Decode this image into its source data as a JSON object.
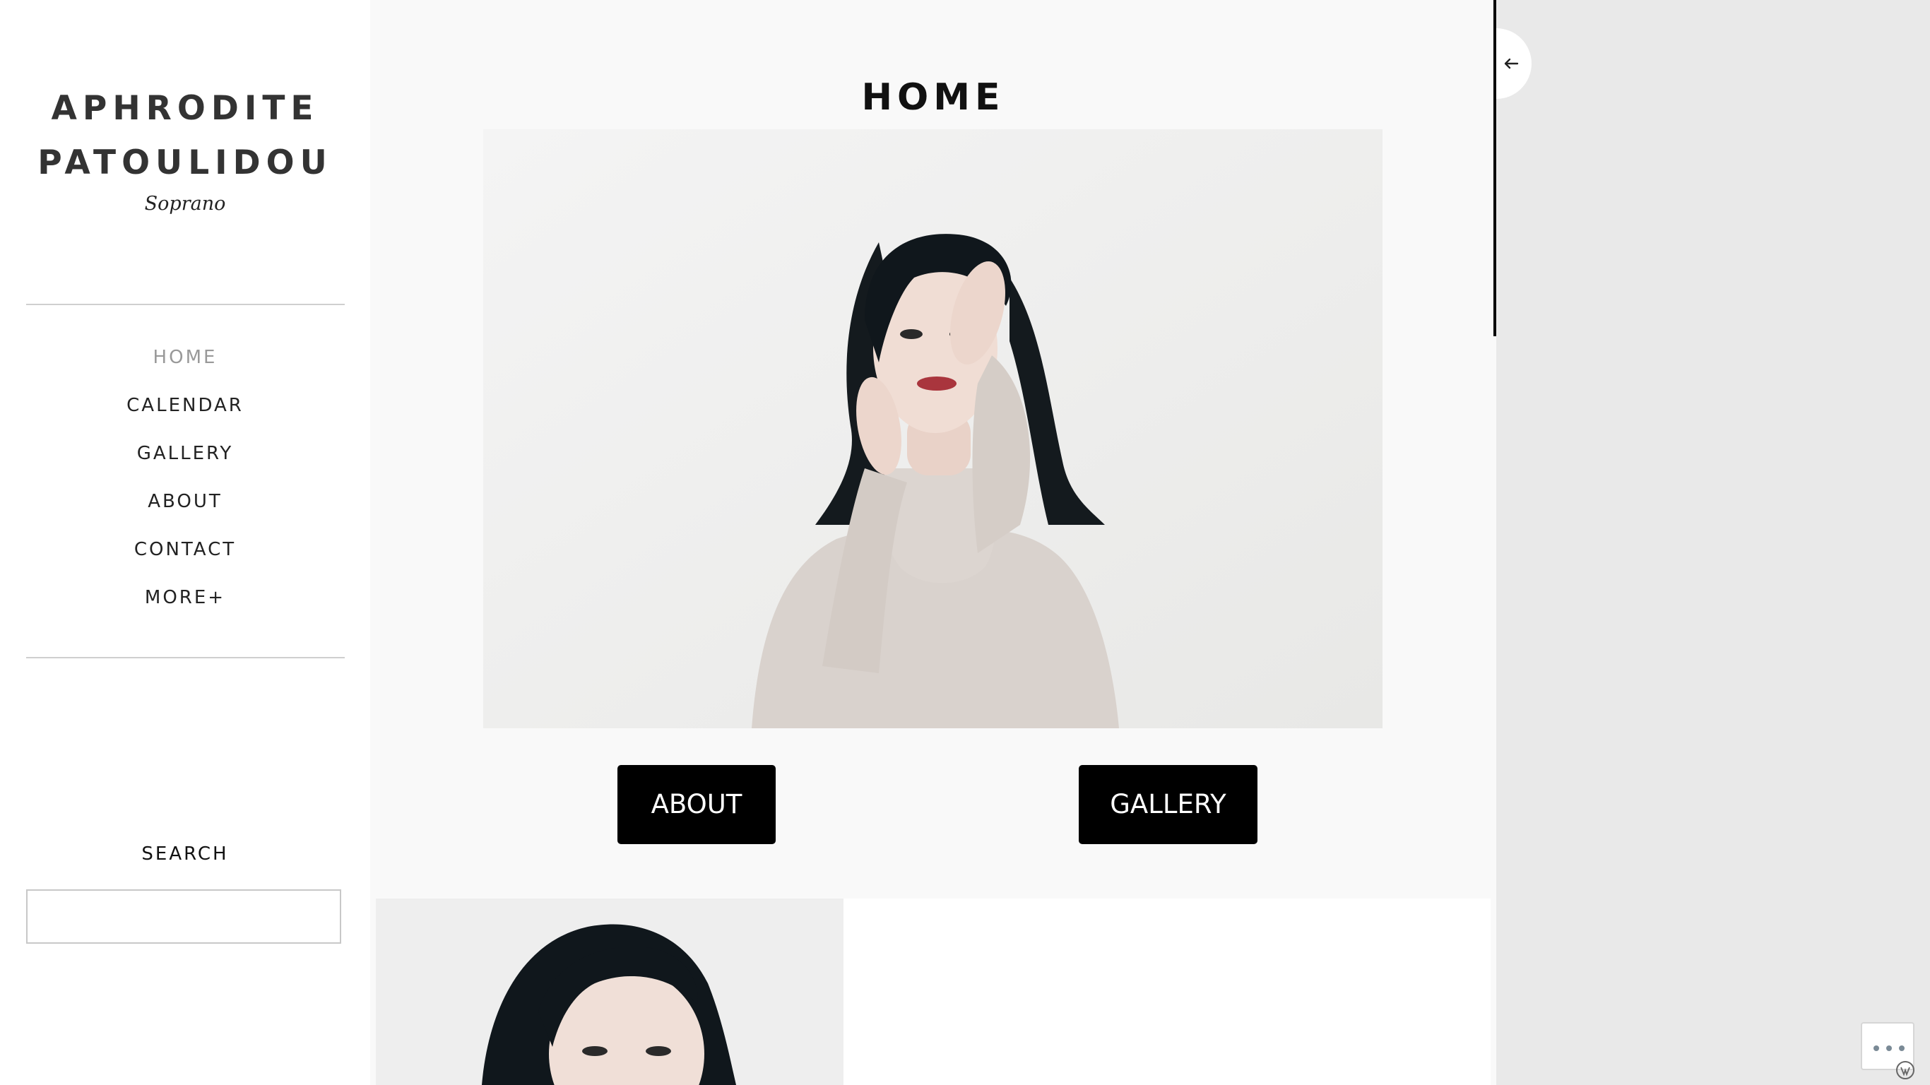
{
  "site": {
    "title_line1": "APHRODITE",
    "title_line2": "PATOULIDOU",
    "tagline": "Soprano"
  },
  "nav": {
    "items": [
      {
        "label": "HOME",
        "current": true
      },
      {
        "label": "CALENDAR"
      },
      {
        "label": "GALLERY"
      },
      {
        "label": "ABOUT"
      },
      {
        "label": "CONTACT"
      },
      {
        "label": "MORE+"
      }
    ]
  },
  "search": {
    "title": "SEARCH",
    "placeholder": ""
  },
  "page": {
    "title": "HOME"
  },
  "buttons": {
    "about": "ABOUT",
    "gallery": "GALLERY"
  },
  "icons": {
    "toggle": "arrow-left-icon",
    "more": "ellipsis-icon",
    "badge": "wordpress-icon"
  },
  "colors": {
    "button_bg": "#000000",
    "nav_current": "#999999",
    "panel_bg": "#e9e9e9"
  }
}
